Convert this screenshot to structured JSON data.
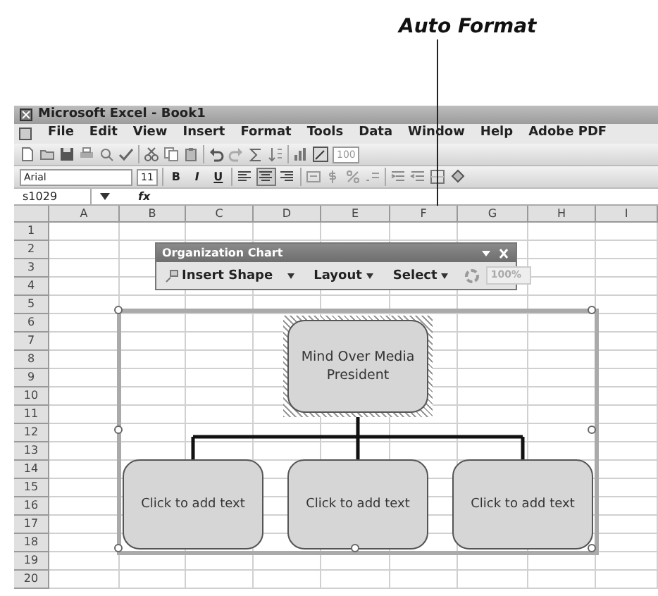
{
  "annotation": {
    "label": "Auto Format"
  },
  "window": {
    "title": "Microsoft Excel - Book1"
  },
  "menu_bar": [
    "File",
    "Edit",
    "View",
    "Insert",
    "Format",
    "Tools",
    "Data",
    "Window",
    "Help",
    "Adobe PDF"
  ],
  "standard_toolbar": {
    "zoom": "100"
  },
  "formatting_toolbar": {
    "font": "Arial",
    "size": "11",
    "styles": [
      {
        "label": "B",
        "kind": "bold"
      },
      {
        "label": "I",
        "kind": "italic"
      },
      {
        "label": "U",
        "kind": "underline"
      }
    ],
    "align": [
      {
        "kind": "left",
        "selected": false
      },
      {
        "kind": "center",
        "selected": true
      },
      {
        "kind": "right",
        "selected": false
      }
    ]
  },
  "formula_bar": {
    "name_box": "s1029",
    "function_label": "fx"
  },
  "sheet": {
    "columns": [
      "A",
      "B",
      "C",
      "D",
      "E",
      "F",
      "G",
      "H",
      "I"
    ],
    "rows": [
      "1",
      "2",
      "3",
      "4",
      "5",
      "6",
      "7",
      "8",
      "9",
      "10",
      "11",
      "12",
      "13",
      "14",
      "15",
      "16",
      "17",
      "18",
      "19",
      "20"
    ]
  },
  "org_chart_toolbar": {
    "title": "Organization Chart",
    "buttons": [
      "Insert Shape",
      "Layout",
      "Select"
    ],
    "zoom": {
      "value": "100%",
      "disabled": true
    }
  },
  "org_chart": {
    "root": {
      "text": "Mind Over Media\nPresident",
      "selected": true,
      "children": [
        {
          "text": "Click to add text",
          "selected": false
        },
        {
          "text": "Click to add text",
          "selected": false
        },
        {
          "text": "Click to add text",
          "selected": false
        }
      ]
    }
  }
}
